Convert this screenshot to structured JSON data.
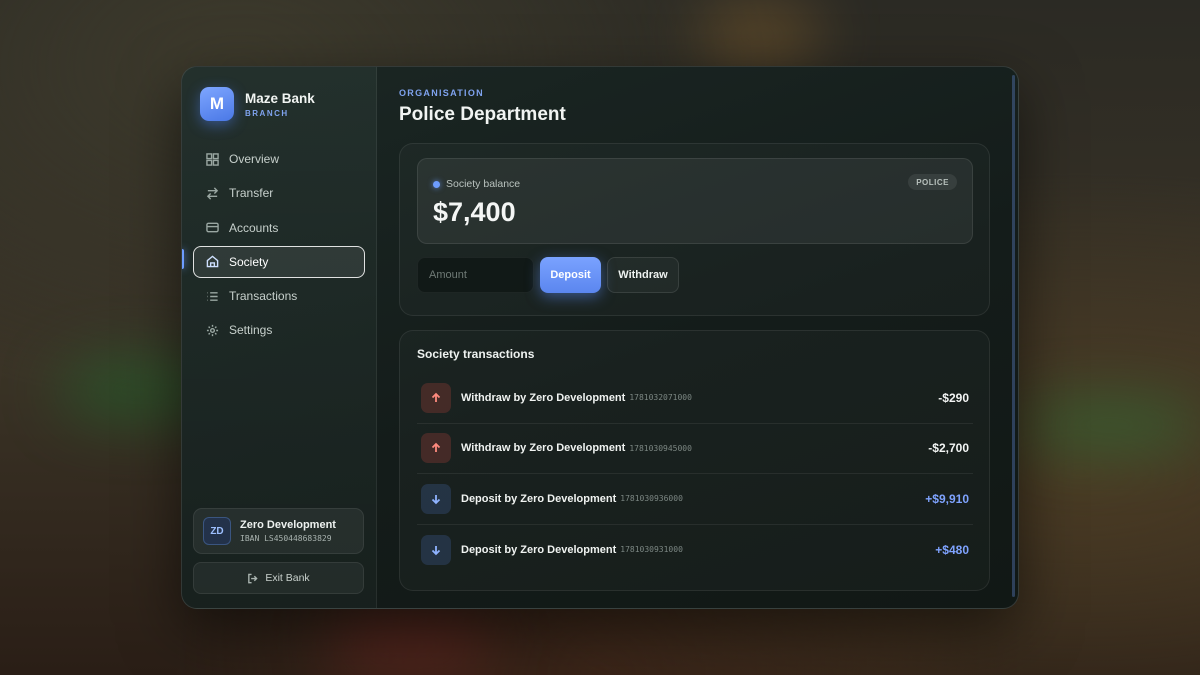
{
  "brand": {
    "logo_letter": "M",
    "name": "Maze Bank",
    "subtitle": "BRANCH"
  },
  "nav": {
    "items": [
      {
        "label": "Overview",
        "icon": "grid-icon",
        "active": false
      },
      {
        "label": "Transfer",
        "icon": "swap-icon",
        "active": false
      },
      {
        "label": "Accounts",
        "icon": "card-icon",
        "active": false
      },
      {
        "label": "Society",
        "icon": "building-icon",
        "active": true
      },
      {
        "label": "Transactions",
        "icon": "list-icon",
        "active": false
      },
      {
        "label": "Settings",
        "icon": "gear-icon",
        "active": false
      }
    ]
  },
  "user": {
    "initials": "ZD",
    "name": "Zero Development",
    "iban": "IBAN LS450448683829"
  },
  "exit_label": "Exit Bank",
  "org": {
    "label": "ORGANISATION",
    "title": "Police Department"
  },
  "balance": {
    "label": "Society balance",
    "value": "$7,400",
    "badge": "POLICE"
  },
  "actions": {
    "amount_placeholder": "Amount",
    "deposit_label": "Deposit",
    "withdraw_label": "Withdraw"
  },
  "transactions": {
    "title": "Society transactions",
    "rows": [
      {
        "type": "withdraw",
        "description": "Withdraw by Zero Development",
        "id": "1781032071000",
        "amount": "-$290"
      },
      {
        "type": "withdraw",
        "description": "Withdraw by Zero Development",
        "id": "1781030945000",
        "amount": "-$2,700"
      },
      {
        "type": "deposit",
        "description": "Deposit by Zero Development",
        "id": "1781030936000",
        "amount": "+$9,910"
      },
      {
        "type": "deposit",
        "description": "Deposit by Zero Development",
        "id": "1781030931000",
        "amount": "+$480"
      }
    ]
  },
  "colors": {
    "accent": "#6d9cff",
    "positive": "#7fa3ff",
    "negative_icon": "#ff8a7e"
  }
}
